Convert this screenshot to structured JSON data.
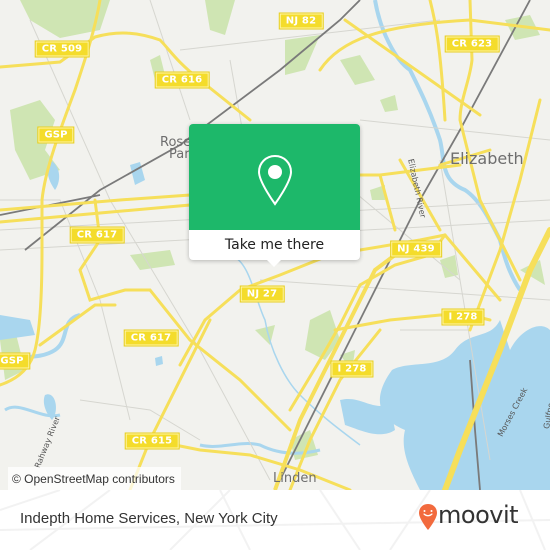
{
  "map": {
    "provider": "OpenStreetMap",
    "attribution": "© OpenStreetMap contributors",
    "colors": {
      "land": "#f2f2ee",
      "park": "#c8e2a8",
      "water": "#a9d6ee",
      "road_major": "#f6df5a",
      "road_minor": "#d6d6d0",
      "rail": "#7a7a7a",
      "shield_bg": "#f4dc2b"
    },
    "places": [
      {
        "name": "Elizabeth"
      },
      {
        "name": "Linden"
      },
      {
        "name": "Roselle Park",
        "visible_text_line1": "Rose",
        "visible_text_line2": "Par"
      }
    ],
    "waterways": [
      {
        "name": "Elizabeth River"
      },
      {
        "name": "Rahway River"
      },
      {
        "name": "Morses Creek"
      },
      {
        "name": "Gulfport",
        "visible_text": "Gulfpo"
      }
    ],
    "road_shields": [
      {
        "label": "CR 509"
      },
      {
        "label": "NJ 82"
      },
      {
        "label": "CR 623"
      },
      {
        "label": "CR 616"
      },
      {
        "label": "GSP"
      },
      {
        "label": "CR 617"
      },
      {
        "label": "NJ 439"
      },
      {
        "label": "NJ 27"
      },
      {
        "label": "I 278"
      },
      {
        "label": "CR 617"
      },
      {
        "label": "GSP"
      },
      {
        "label": "I 278"
      },
      {
        "label": "CR 615"
      }
    ]
  },
  "popup": {
    "icon": "location-pin-icon",
    "cta_label": "Take me there",
    "accent_color": "#1db86a"
  },
  "footer": {
    "title": "Indepth Home Services, New York City",
    "brand": "moovit",
    "brand_color": "#f26a3d"
  }
}
